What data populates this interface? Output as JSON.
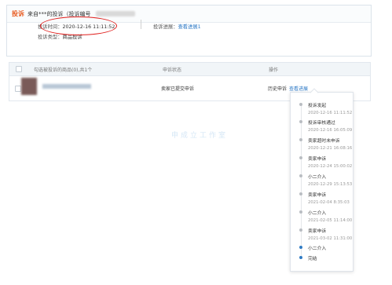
{
  "complaint": {
    "tag": "投诉",
    "header_text": "来自***的投诉（投诉编号",
    "time_label": "投诉时间：",
    "time_value": "2020-12-16 11:11:52",
    "type_label": "投诉类型：",
    "type_value": "商品投诉",
    "progress_label": "投诉进展：",
    "progress_link": "查看进展1"
  },
  "table": {
    "headers": [
      "勾选被投诉的商品(0),共1个",
      "申诉状态",
      "操作"
    ],
    "row": {
      "status": "卖家已提交申诉",
      "history_label": "历史申诉",
      "progress_link": "查看进展"
    }
  },
  "watermark": "申成立工作室",
  "timeline": [
    {
      "label": "投诉发起",
      "time": "2020-12-16 11:11:52",
      "active": false
    },
    {
      "label": "投诉审核通过",
      "time": "2020-12-16 16:05:09",
      "active": false
    },
    {
      "label": "卖家超时未申诉",
      "time": "2020-12-21 16:08:16",
      "active": false
    },
    {
      "label": "卖家申诉",
      "time": "2020-12-24 15:00:02",
      "active": false
    },
    {
      "label": "小二介入",
      "time": "2020-12-29 15:13:53",
      "active": false
    },
    {
      "label": "卖家申诉",
      "time": "2021-02-04 8:35:03",
      "active": false
    },
    {
      "label": "小二介入",
      "time": "2021-02-05 11:14:00",
      "active": false
    },
    {
      "label": "卖家申诉",
      "time": "2021-03-02 11:31:00",
      "active": false
    },
    {
      "label": "小二介入",
      "time": "",
      "active": true
    },
    {
      "label": "完结",
      "time": "",
      "active": true
    }
  ],
  "colors": {
    "tag": "#e85a1f",
    "link": "#2b78c5",
    "highlight_circle": "#e0201e",
    "active_dot": "#2f7bc4"
  }
}
